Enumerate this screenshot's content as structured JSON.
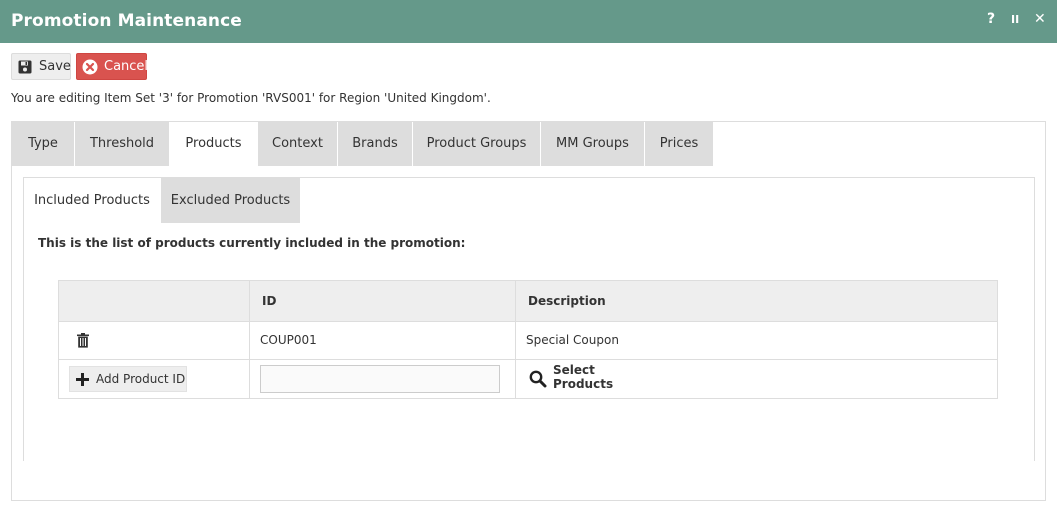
{
  "window": {
    "title": "Promotion Maintenance",
    "controls": {
      "help": "?",
      "pause": "II",
      "close": "✕"
    },
    "accent_color": "#65998a"
  },
  "toolbar": {
    "save_label": "Save",
    "save_icon": "floppy-disk-icon",
    "cancel_label": "Cancel",
    "cancel_icon": "circle-x-icon",
    "cancel_color": "#d9534f"
  },
  "info_text": "You are editing Item Set '3' for Promotion 'RVS001' for Region 'United Kingdom'.",
  "tabs": [
    {
      "label": "Type"
    },
    {
      "label": "Threshold"
    },
    {
      "label": "Products",
      "active": true
    },
    {
      "label": "Context"
    },
    {
      "label": "Brands"
    },
    {
      "label": "Product Groups"
    },
    {
      "label": "MM Groups"
    },
    {
      "label": "Prices"
    }
  ],
  "subtabs": [
    {
      "label": "Included Products",
      "active": true
    },
    {
      "label": "Excluded Products"
    }
  ],
  "description": "This is the list of products currently included in the promotion:",
  "table": {
    "columns": [
      "",
      "ID",
      "Description"
    ],
    "rows": [
      {
        "id": "COUP001",
        "description": "Special Coupon",
        "action_icon": "trash-icon"
      }
    ]
  },
  "add_row": {
    "add_button_label": "Add Product ID",
    "add_icon": "plus-icon",
    "input_value": "",
    "input_placeholder": "",
    "select_label": "Select Products",
    "select_icon": "search-icon"
  }
}
